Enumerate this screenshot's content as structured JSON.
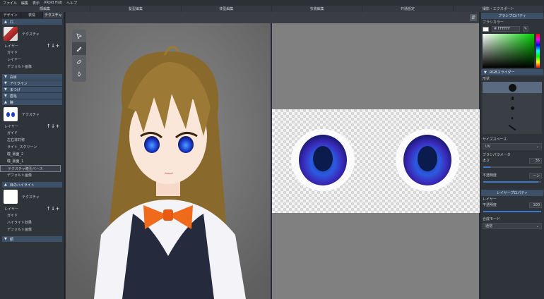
{
  "menubar": {
    "items": [
      "ファイル",
      "編集",
      "表示",
      "VRoid Hub",
      "ヘルプ"
    ]
  },
  "modebar": {
    "items": [
      "顔編集",
      "髪型編集",
      "体型編集",
      "衣装編集",
      "共通設定",
      "撮影・エクスポート"
    ]
  },
  "left": {
    "tabs": [
      "デザイン",
      "表情",
      "テクスチャ"
    ],
    "sections": {
      "mouth": "口",
      "whites": "白目",
      "eyeline": "アイライン",
      "lashes": "まつげ",
      "brow": "眉毛",
      "eye": "瞳",
      "highlight": "目のハイライト",
      "face": "顔"
    },
    "texture_label": "テクスチャ",
    "layer_label": "レイヤー",
    "layer_counter": "↑↓+",
    "mouth_layers": [
      "ガイド",
      "レイヤー",
      "デフォルト画像"
    ],
    "eye_layers": [
      "ガイド",
      "左右非対称",
      "ライト_スクリーン",
      "瞳_裏面_2",
      "瞳_裏面_1",
      "テクスチャ瞳孔ベース",
      "デフォルト画像"
    ],
    "highlight_layers": [
      "ガイド",
      "ハイライト効果",
      "デフォルト画像"
    ]
  },
  "right": {
    "brush_props_title": "ブラシプロパティ",
    "brush_color_label": "ブラシカラー",
    "hex_value": "# FFFFFF",
    "rgb_slider_label": "RGBスライダー",
    "shape_label": "形状",
    "size_space_label": "サイズスペース",
    "size_space_value": "UV",
    "brush_param_label": "ブラシパラメータ",
    "thickness_label": "太さ",
    "thickness_value": "35",
    "thickness_ratio": 0.12,
    "opacity_label": "不透明度",
    "opacity_value": "ーン",
    "opacity_ratio": 0.95,
    "layer_props_title": "レイヤープロパティ",
    "layer_label": "レイヤー",
    "layer_opacity_label": "不透明度",
    "layer_opacity_value": "100",
    "layer_opacity_ratio": 1.0,
    "blend_label": "合成モード",
    "blend_value": "通常"
  },
  "colors": {
    "accent": "#3c5068",
    "slider": "#3c78c8",
    "iris": "#1f3ec8"
  }
}
